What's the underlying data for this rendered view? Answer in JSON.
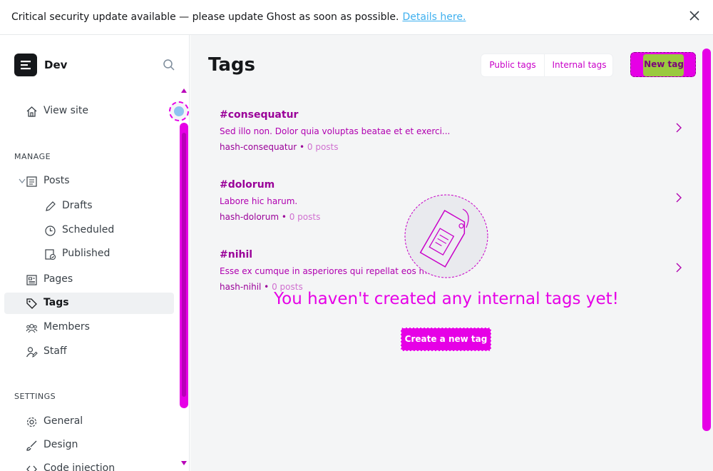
{
  "banner": {
    "message": "Critical security update available — please update Ghost as soon as possible.",
    "link_label": "Details here."
  },
  "sidebar": {
    "site_name": "Dev",
    "view_site": "View site",
    "manage_title": "MANAGE",
    "settings_title": "SETTINGS",
    "items": {
      "posts": "Posts",
      "drafts": "Drafts",
      "scheduled": "Scheduled",
      "published": "Published",
      "pages": "Pages",
      "tags": "Tags",
      "members": "Members",
      "staff": "Staff",
      "general": "General",
      "design": "Design",
      "code_injection": "Code injection"
    }
  },
  "main": {
    "title": "Tags",
    "public_tags": "Public tags",
    "internal_tags": "Internal tags",
    "new_tag": "New tag",
    "tags": [
      {
        "name": "#consequatur",
        "description": "Sed illo non. Dolor quia voluptas beatae et et exerci...",
        "slug": "hash-consequatur",
        "posts": "0 posts"
      },
      {
        "name": "#dolorum",
        "description": "Labore hic harum.",
        "slug": "hash-dolorum",
        "posts": "0 posts"
      },
      {
        "name": "#nihil",
        "description": "Esse ex cumque in asperiores qui repellat eos magn...",
        "slug": "hash-nihil",
        "posts": "0 posts"
      }
    ],
    "empty_message": "You haven't created any internal tags yet!",
    "create_button": "Create a new tag"
  },
  "colors": {
    "accent": "#e600e6",
    "link": "#3eb0ef",
    "active_bg": "#eff1f3",
    "highlight": "#9ac93f"
  },
  "icons": {
    "banner_close": "close-icon",
    "sidebar_search": "search-icon",
    "tag_row": "chevron-right-icon",
    "empty_state": "tag-illustration-icon"
  }
}
